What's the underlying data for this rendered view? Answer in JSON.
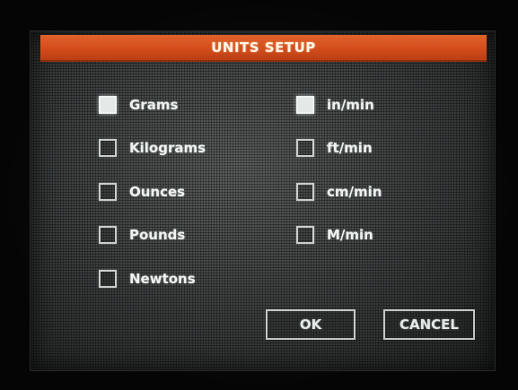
{
  "dialog": {
    "title": "UNITS SETUP"
  },
  "force_units": [
    {
      "label": "Grams",
      "checked": true
    },
    {
      "label": "Kilograms",
      "checked": false
    },
    {
      "label": "Ounces",
      "checked": false
    },
    {
      "label": "Pounds",
      "checked": false
    },
    {
      "label": "Newtons",
      "checked": false
    }
  ],
  "speed_units": [
    {
      "label": "in/min",
      "checked": true
    },
    {
      "label": "ft/min",
      "checked": false
    },
    {
      "label": "cm/min",
      "checked": false
    },
    {
      "label": "M/min",
      "checked": false
    }
  ],
  "buttons": {
    "ok_label": "OK",
    "cancel_label": "CANCEL"
  },
  "colors": {
    "title_bar": "#d14b1a",
    "screen_background": "#3b3e3e",
    "text": "#eef1ef"
  }
}
